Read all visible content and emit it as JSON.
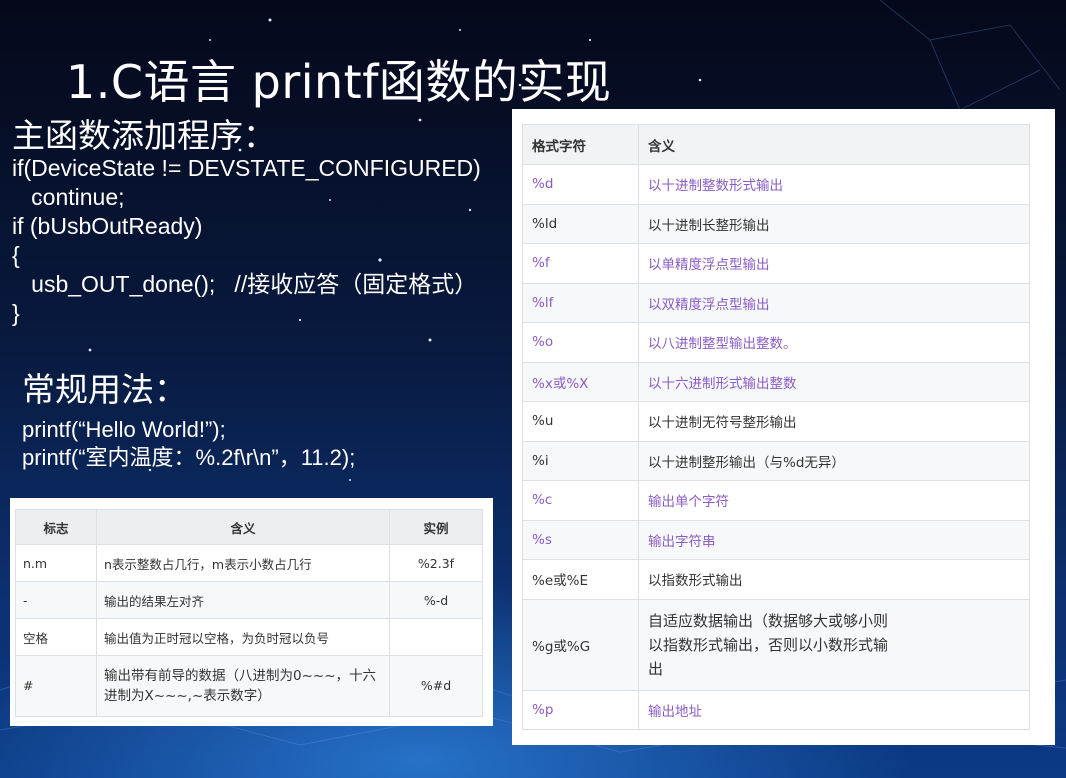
{
  "slide": {
    "title": "1.C语言 printf函数的实现",
    "main_program": {
      "heading": "主函数添加程序：",
      "lines": [
        "if(DeviceState != DEVSTATE_CONFIGURED)",
        "   continue;",
        "if (bUsbOutReady)",
        "{",
        "   usb_OUT_done();   //接收应答（固定格式）",
        "}"
      ]
    },
    "usage": {
      "heading": "常规用法：",
      "lines": [
        "printf(“Hello World!”);",
        "printf(“室内温度：%.2f\\r\\n”，11.2);"
      ]
    }
  },
  "format_table": {
    "headers": [
      "格式字符",
      "含义"
    ],
    "rows": [
      {
        "code": "%d",
        "meaning": "以十进制整数形式输出",
        "link": true
      },
      {
        "code": "%ld",
        "meaning": "以十进制长整形输出",
        "link": false
      },
      {
        "code": "%f",
        "meaning": "以单精度浮点型输出",
        "link": true
      },
      {
        "code": "%lf",
        "meaning": "以双精度浮点型输出",
        "link": true
      },
      {
        "code": "%o",
        "meaning": "以八进制整型输出整数。",
        "link": true
      },
      {
        "code": "%x或%X",
        "meaning": "以十六进制形式输出整数",
        "link": true
      },
      {
        "code": "%u",
        "meaning": "以十进制无符号整形输出",
        "link": false
      },
      {
        "code": "%i",
        "meaning": "以十进制整形输出（与%d无异）",
        "link": false
      },
      {
        "code": "%c",
        "meaning": "输出单个字符",
        "link": true
      },
      {
        "code": "%s",
        "meaning": "输出字符串",
        "link": true
      },
      {
        "code": "%e或%E",
        "meaning": "以指数形式输出",
        "link": false
      },
      {
        "code": "%g或%G",
        "meaning": "自适应数据输出（数据够大或够小则以指数形式输出，否则以小数形式输出",
        "link": false
      },
      {
        "code": "%p",
        "meaning": "输出地址",
        "link": true
      }
    ]
  },
  "flag_table": {
    "headers": [
      "标志",
      "含义",
      "实例"
    ],
    "rows": [
      {
        "flag": "n.m",
        "meaning": "n表示整数占几行，m表示小数占几行",
        "example": "%2.3f"
      },
      {
        "flag": "-",
        "meaning": "输出的结果左对齐",
        "example": "%-d"
      },
      {
        "flag": "空格",
        "meaning": "输出值为正时冠以空格，为负时冠以负号",
        "example": ""
      },
      {
        "flag": "#",
        "meaning": "输出带有前导的数据（八进制为0~~~，十六进制为X~~~,~表示数字）",
        "example": "%#d"
      }
    ]
  },
  "colors": {
    "link": "#8a5cc7",
    "background_top": "#05081a",
    "background_bottom": "#0c3a86"
  }
}
